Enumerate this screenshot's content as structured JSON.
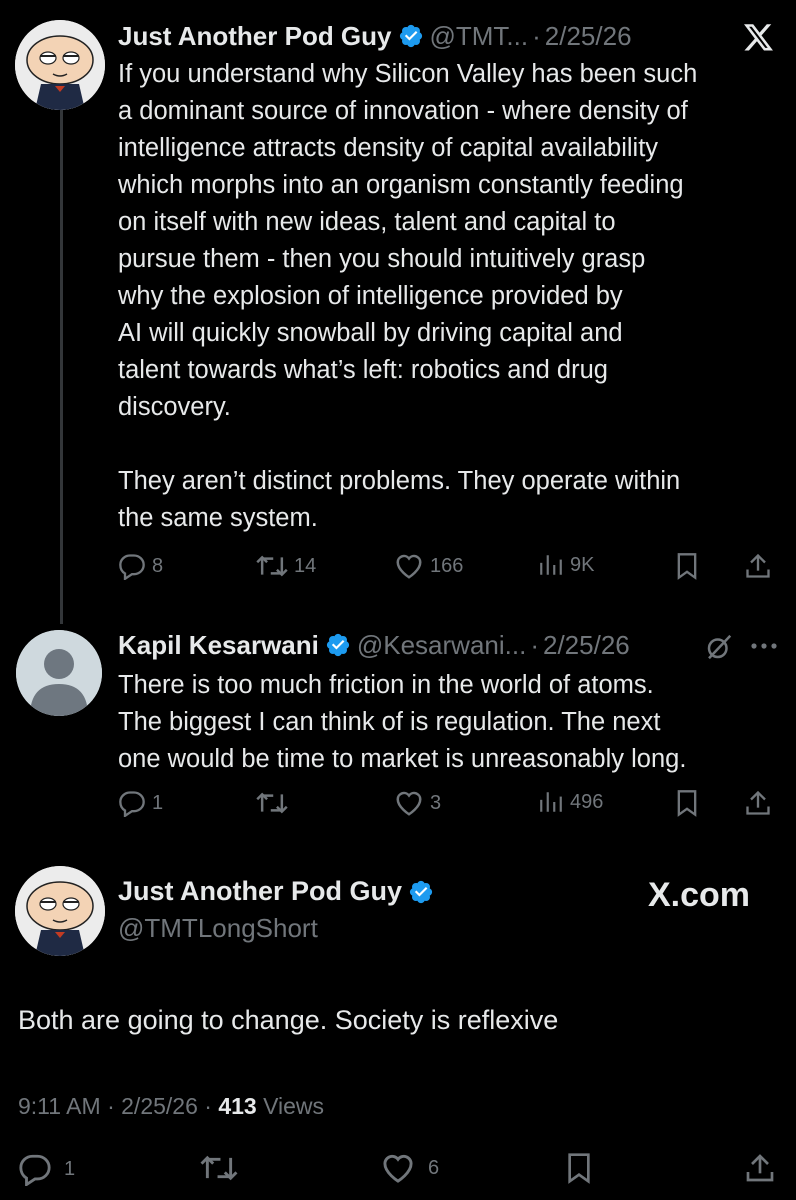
{
  "tweet1": {
    "name": "Just Another Pod Guy",
    "handle": "@TMT...",
    "separator": "·",
    "date": "2/25/26",
    "avatar_icon": "stewie-avatar",
    "body": "If you understand why Silicon Valley has been such\na dominant source of innovation - where density of\nintelligence attracts density of capital availability\nwhich morphs into an organism constantly feeding\non itself with new ideas, talent and capital to\npursue them - then you should intuitively grasp\nwhy the explosion of intelligence provided by\n AI will quickly snowball by driving capital and\ntalent towards what’s left: robotics and drug\ndiscovery.\n\nThey aren’t distinct problems.  They operate within\nthe same system.",
    "actions": {
      "replies": "8",
      "reposts": "14",
      "likes": "166",
      "views": "9K"
    }
  },
  "tweet2": {
    "name": "Kapil Kesarwani",
    "handle": "@Kesarwani...",
    "separator": "·",
    "date": "2/25/26",
    "body": "There is too much friction in the world of atoms.\nThe biggest I can think of is regulation. The next\none would be time to market is unreasonably long.",
    "actions": {
      "replies": "1",
      "reposts": "",
      "likes": "3",
      "views": "496"
    }
  },
  "main_tweet": {
    "name": "Just Another Pod Guy",
    "handle": "@TMTLongShort",
    "watermark": "X.com",
    "body": "Both are going to change. Society is reflexive",
    "time": "9:11 AM",
    "separator": "·",
    "date": "2/25/26",
    "views_count": "413",
    "views_label": "Views",
    "actions": {
      "replies": "1",
      "reposts": "",
      "likes": "6"
    }
  },
  "colors": {
    "background": "#000000",
    "text": "#e7e9ea",
    "muted": "#71767b",
    "verified": "#1d9bf0",
    "thread_line": "#333639"
  }
}
